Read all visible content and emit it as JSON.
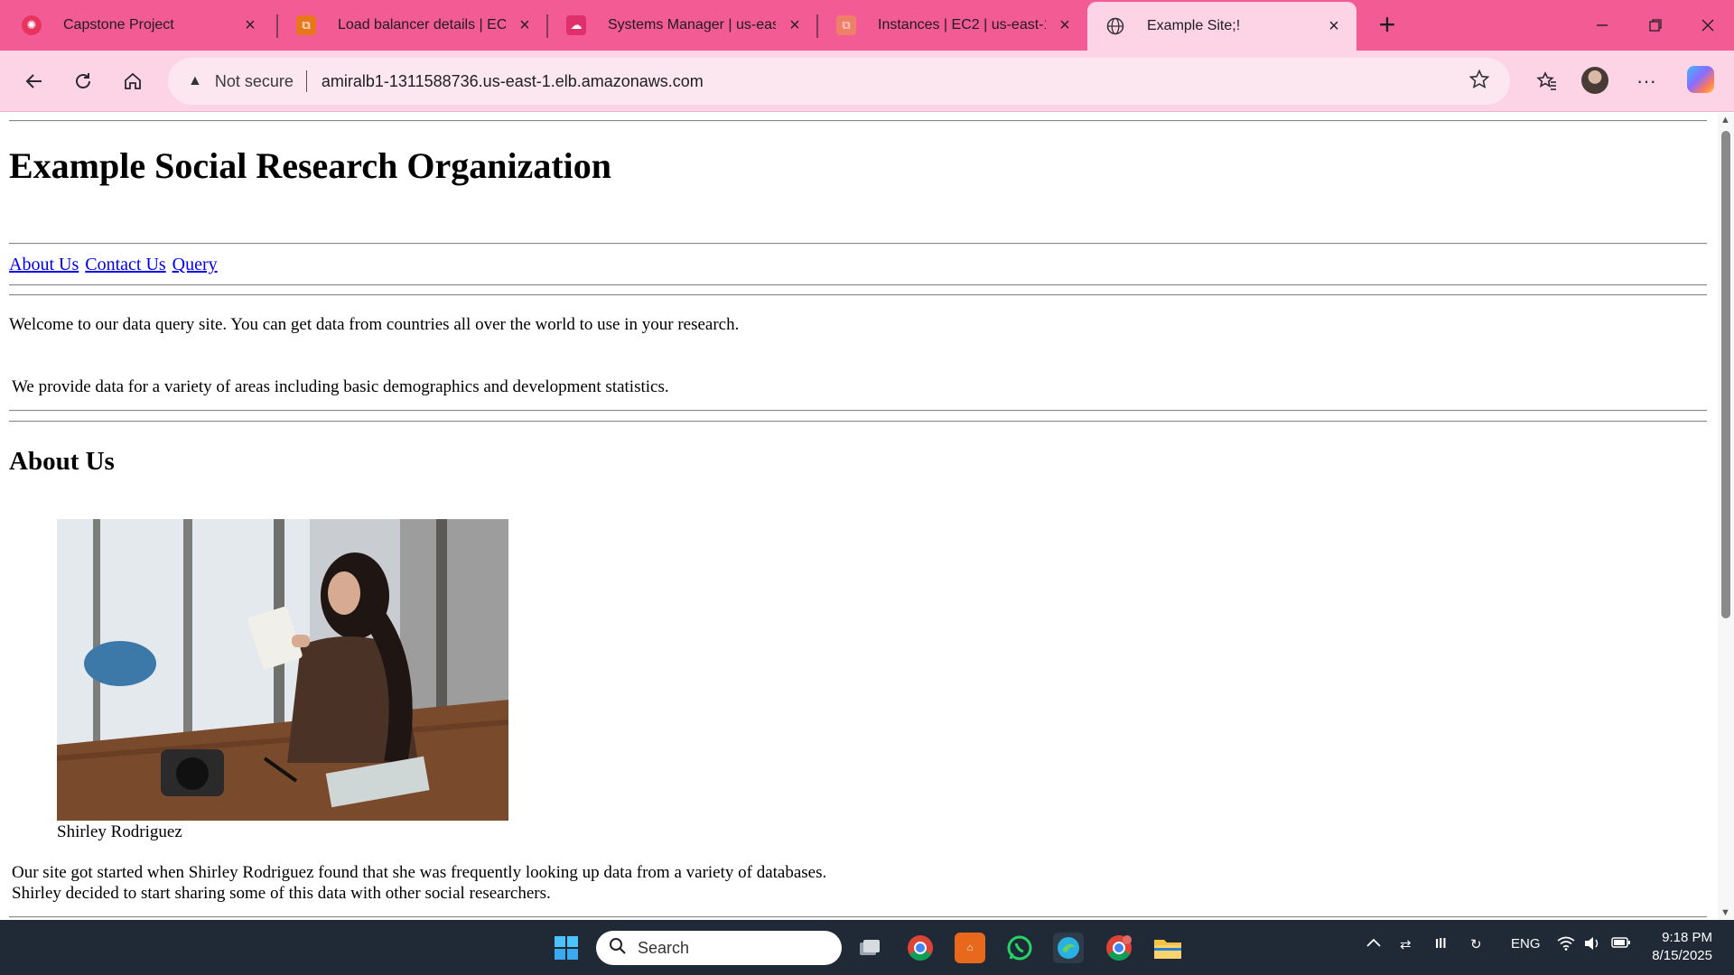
{
  "browser": {
    "tabs": [
      {
        "title": "Capstone Project",
        "favicon_color": "#e8335f"
      },
      {
        "title": "Load balancer details | EC2",
        "favicon_color": "#e8771c"
      },
      {
        "title": "Systems Manager | us-east-",
        "favicon_color": "#e0306b"
      },
      {
        "title": "Instances | EC2 | us-east-1",
        "favicon_color": "#e8771c"
      },
      {
        "title": "Example Site;!",
        "favicon_color": "#3a3a3a"
      }
    ],
    "security_label": "Not secure",
    "url": "amiralb1-1311588736.us-east-1.elb.amazonaws.com"
  },
  "page": {
    "title": "Example Social Research Organization",
    "nav": [
      "About Us",
      "Contact Us",
      "Query"
    ],
    "intro": "Welcome to our data query site. You can get data from countries all over the world to use in your research.",
    "provide": "We provide data for a variety of areas including basic demographics and development statistics.",
    "about_heading": "About Us",
    "photo_caption": "Shirley Rodriguez",
    "story_line1": "Our site got started when Shirley Rodriguez found that she was frequently looking up data from a variety of databases.",
    "story_line2": "Shirley decided to start sharing some of this data with other social researchers."
  },
  "taskbar": {
    "search_placeholder": "Search",
    "language": "ENG",
    "time": "9:18 PM",
    "date": "8/15/2025"
  },
  "colors": {
    "tabstrip": "#f35b95",
    "toolbar": "#fdd3e6",
    "link": "#0000ee",
    "taskbar": "#1f2a36"
  }
}
